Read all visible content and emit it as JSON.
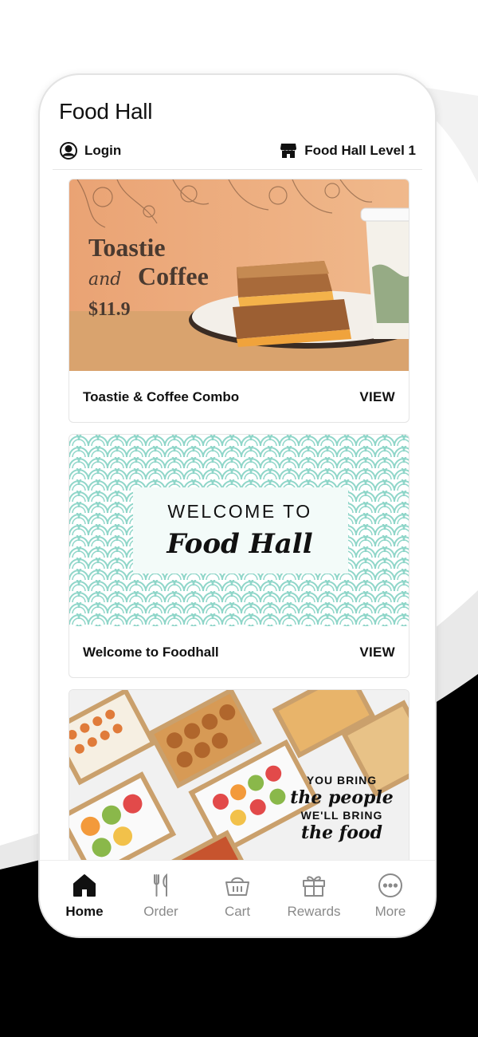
{
  "app": {
    "title": "Food Hall"
  },
  "header": {
    "login_label": "Login",
    "location_label": "Food Hall Level 1"
  },
  "cards": [
    {
      "title": "Toastie & Coffee Combo",
      "action": "VIEW",
      "image_text": {
        "line1": "Toastie",
        "line2_script": "and",
        "line2": "Coffee",
        "price": "$11.9"
      }
    },
    {
      "title": "Welcome to Foodhall",
      "action": "VIEW",
      "image_text": {
        "line1": "WELCOME TO",
        "line2": "Food Hall"
      }
    },
    {
      "image_text": {
        "l1": "YOU BRING",
        "l2": "the people",
        "l3": "WE'LL BRING",
        "l4": "the food"
      }
    }
  ],
  "tabs": [
    {
      "label": "Home",
      "icon": "home-icon",
      "active": true
    },
    {
      "label": "Order",
      "icon": "fork-knife-icon"
    },
    {
      "label": "Cart",
      "icon": "basket-icon"
    },
    {
      "label": "Rewards",
      "icon": "gift-icon"
    },
    {
      "label": "More",
      "icon": "more-icon"
    }
  ],
  "colors": {
    "accent": "#111111",
    "inactive_tab": "#8a8a8a",
    "banner_orange": "#e9a77a",
    "banner_teal": "#8fd6c9"
  }
}
